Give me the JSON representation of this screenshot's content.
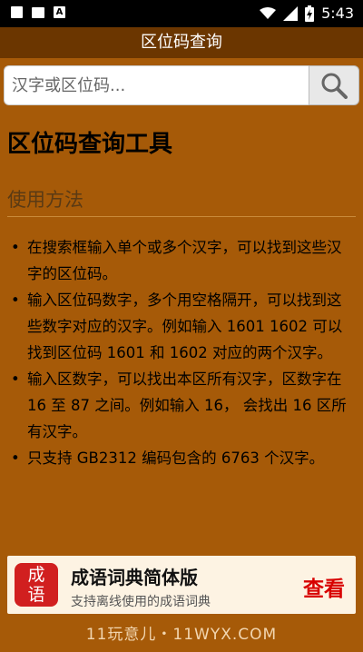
{
  "status_bar": {
    "time": "5:43",
    "icons": [
      "photo-icon",
      "book-icon",
      "a-icon",
      "wifi-icon",
      "signal-icon",
      "battery-charging-icon"
    ]
  },
  "app_bar": {
    "title": "区位码查询"
  },
  "search": {
    "placeholder": "汉字或区位码...",
    "button_icon": "search-icon"
  },
  "main": {
    "title": "区位码查询工具",
    "section_title": "使用方法",
    "usage_items": [
      "在搜索框输入单个或多个汉字，可以找到这些汉字的区位码。",
      "输入区位码数字，多个用空格隔开，可以找到这些数字对应的汉字。例如输入 1601 1602 可以找到区位码 1601 和 1602 对应的两个汉字。",
      "输入区数字，可以找出本区所有汉字，区数字在 16 至 87 之间。例如输入 16， 会找出 16 区所有汉字。",
      "只支持 GB2312 编码包含的 6763 个汉字。"
    ]
  },
  "promo": {
    "logo_text_top": "成",
    "logo_text_bottom": "语",
    "title": "成语词典简体版",
    "subtitle": "支持离线使用的成语词典",
    "action": "查看"
  },
  "watermark": "11玩意儿・11WYX.COM"
}
